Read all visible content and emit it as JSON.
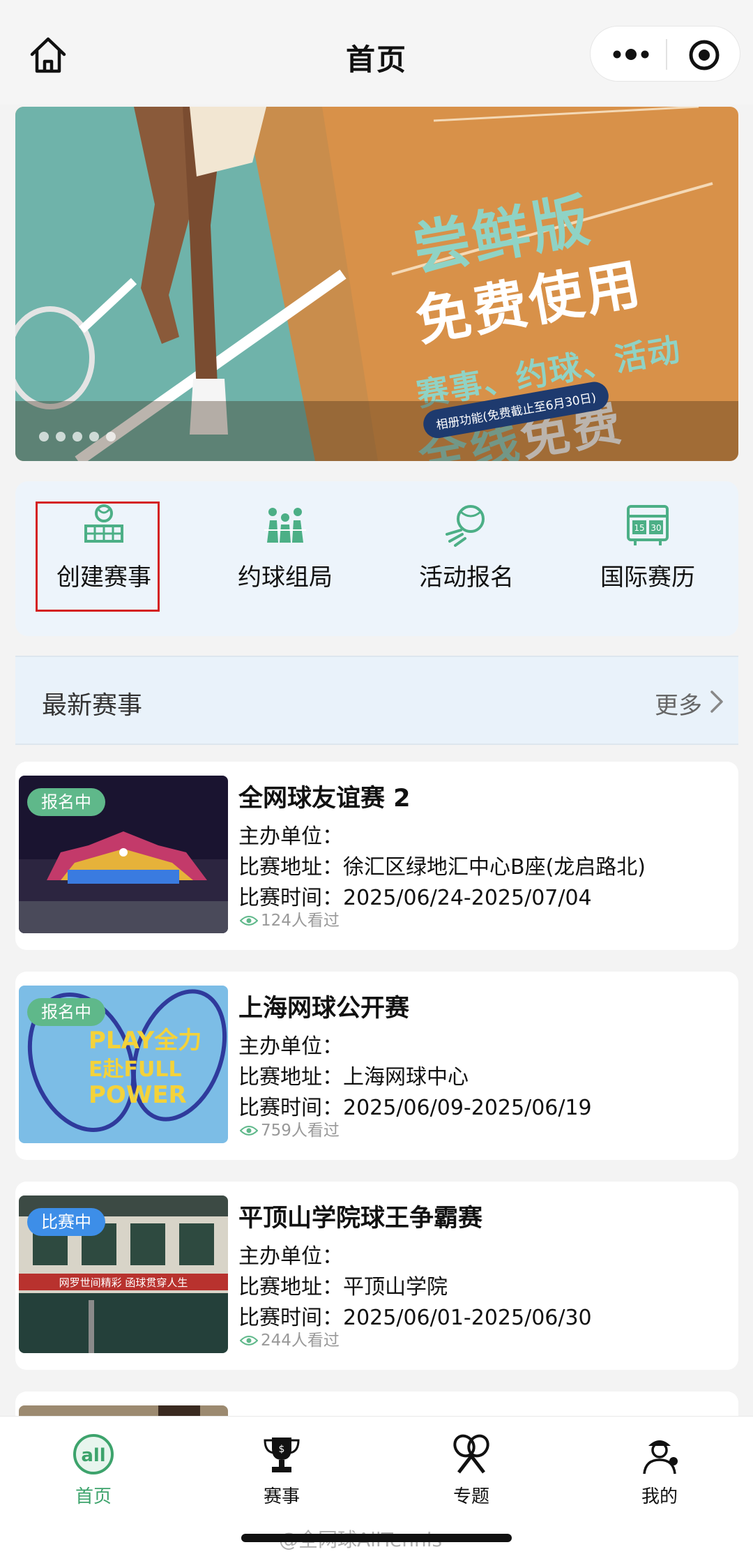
{
  "header": {
    "title": "首页"
  },
  "banner": {
    "line1": "尝鲜版",
    "line2": "免费使用",
    "line3": "赛事、约球、活动",
    "line4_a": "全线",
    "line4_b": "免费",
    "badge": "相册功能(免费截止至6月30日)"
  },
  "quicknav": [
    {
      "label": "创建赛事",
      "icon": "create-event-icon"
    },
    {
      "label": "约球组局",
      "icon": "group-match-icon"
    },
    {
      "label": "活动报名",
      "icon": "activity-signup-icon"
    },
    {
      "label": "国际赛历",
      "icon": "international-calendar-icon"
    }
  ],
  "latest": {
    "title": "最新赛事",
    "more": "更多"
  },
  "events": [
    {
      "badge": "报名中",
      "title": "全网球友谊赛 2",
      "organizer": "主办单位：",
      "address_key": "比赛地址：",
      "address": "徐汇区绿地汇中心B座(龙启路北)",
      "time_key": "比赛时间：",
      "time": "2025/06/24-2025/07/04",
      "views": "124人看过"
    },
    {
      "badge": "报名中",
      "title": "上海网球公开赛",
      "organizer": "主办单位：",
      "address_key": "比赛地址：",
      "address": "上海网球中心",
      "time_key": "比赛时间：",
      "time": "2025/06/09-2025/06/19",
      "views": "759人看过"
    },
    {
      "badge": "比赛中",
      "title": "平顶山学院球王争霸赛",
      "organizer": "主办单位：",
      "address_key": "比赛地址：",
      "address": "平顶山学院",
      "time_key": "比赛时间：",
      "time": "2025/06/01-2025/06/30",
      "views": "244人看过"
    }
  ],
  "thumb2_text": {
    "a": "PLAY全力",
    "b": "E赴FULL",
    "c": "POWER"
  },
  "thumb3_text": "网罗世间精彩 函球贯穿人生",
  "tabs": [
    {
      "label": "首页"
    },
    {
      "label": "赛事"
    },
    {
      "label": "专题"
    },
    {
      "label": "我的"
    }
  ],
  "watermark": "@全网球AllTennis",
  "colors": {
    "accent": "#3da36c",
    "badge_green": "#5fb88a",
    "badge_blue": "#3d8ee8",
    "highlight": "#d42020"
  }
}
